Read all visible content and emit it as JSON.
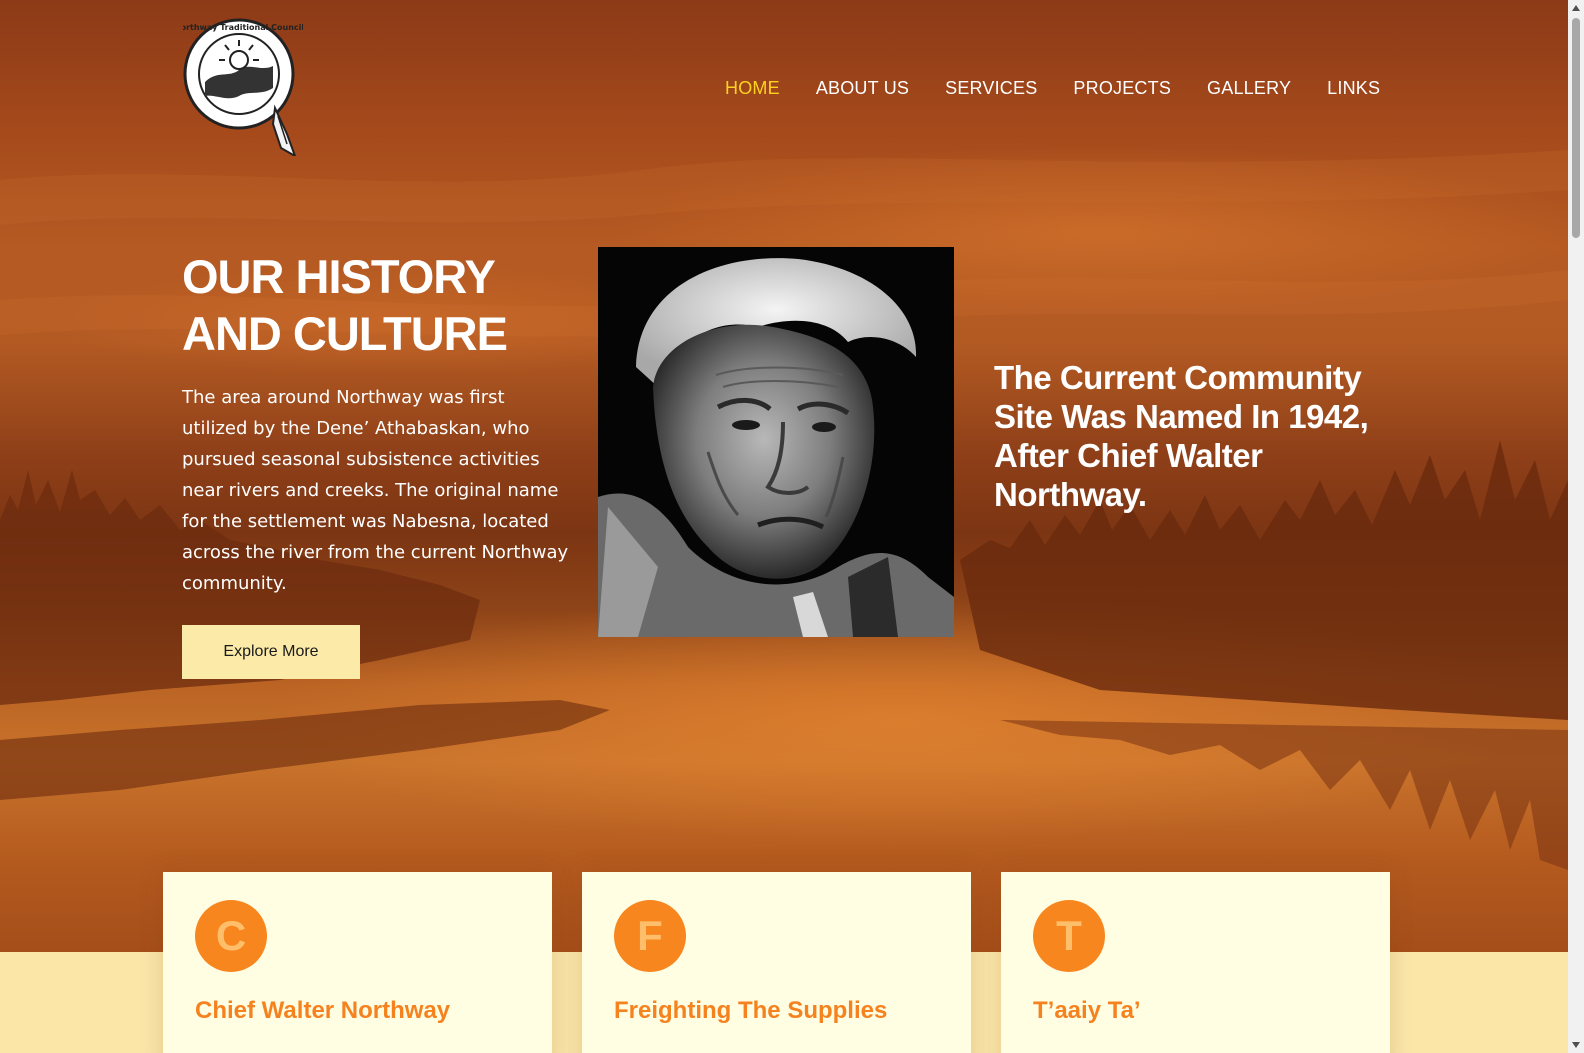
{
  "brand": {
    "logo_text": "Northway Traditional Council"
  },
  "nav": {
    "items": [
      {
        "label": "HOME",
        "active": true
      },
      {
        "label": "ABOUT US",
        "active": false
      },
      {
        "label": "SERVICES",
        "active": false
      },
      {
        "label": "PROJECTS",
        "active": false
      },
      {
        "label": "GALLERY",
        "active": false
      },
      {
        "label": "LINKS",
        "active": false
      }
    ]
  },
  "hero": {
    "title": "OUR HISTORY AND CULTURE",
    "body": "The area around Northway was first utilized by the Dene’ Athabaskan, who pursued seasonal subsistence activities near rivers and creeks. The original name for the settlement was Nabesna, located across the river from the current Northway community.",
    "button_label": "Explore More",
    "quote": "The Current Community Site Was Named In 1942, After Chief Walter Northway."
  },
  "cards": [
    {
      "letter": "C",
      "title": "Chief Walter Northway"
    },
    {
      "letter": "F",
      "title": "Freighting The Supplies"
    },
    {
      "letter": "T",
      "title": "T’aaiy Ta’"
    }
  ],
  "colors": {
    "nav_active": "#ffd21f",
    "button_bg": "#fbeaa8",
    "card_bg": "#fffde2",
    "accent_orange": "#f5821f",
    "band_bg": "#fbe6a8"
  }
}
